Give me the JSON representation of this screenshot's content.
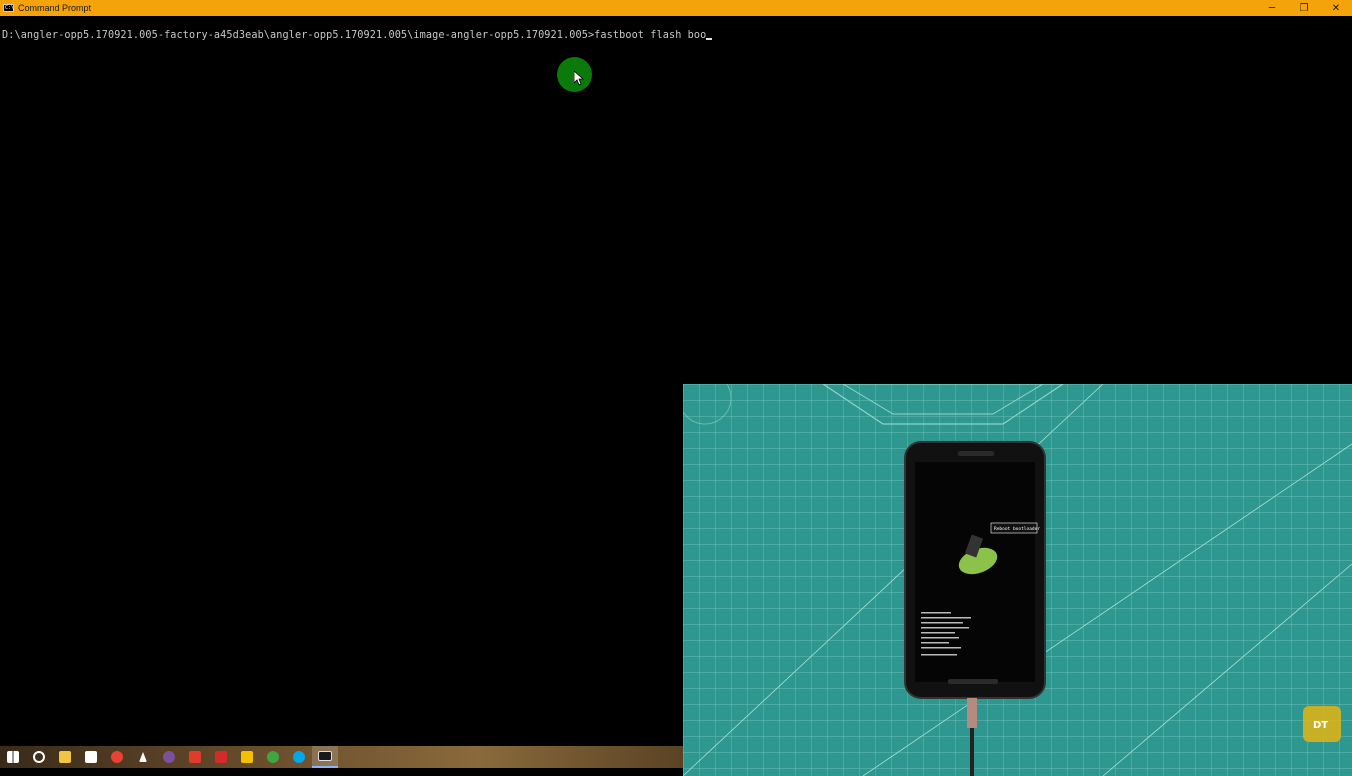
{
  "window": {
    "title": "Command Prompt",
    "icon_label": "C:\\",
    "controls": {
      "minimize": "─",
      "restore": "❐",
      "close": "✕"
    }
  },
  "console": {
    "prompt": "D:\\angler-opp5.170921.005-factory-a45d3eab\\angler-opp5.170921.005\\image-angler-opp5.170921.005>",
    "typed_command": "fastboot flash boo"
  },
  "video_overlay": {
    "phone_menu_label": "Reboot bootloader",
    "watermark": "DT"
  },
  "taskbar": {
    "items": [
      {
        "name": "start-button",
        "icon": "windows-icon",
        "color": "#ffffff"
      },
      {
        "name": "cortana-button",
        "icon": "circle-icon",
        "color": "#ffffff"
      },
      {
        "name": "file-explorer",
        "icon": "folder-icon",
        "color": "#f4c542"
      },
      {
        "name": "store",
        "icon": "bag-icon",
        "color": "#ffffff"
      },
      {
        "name": "chrome",
        "icon": "chrome-icon",
        "color": "#e94235"
      },
      {
        "name": "app-lightning",
        "icon": "lightning-icon",
        "color": "#ffffff"
      },
      {
        "name": "viber",
        "icon": "viber-icon",
        "color": "#7b519d"
      },
      {
        "name": "app-red",
        "icon": "red-app-icon",
        "color": "#e03b2c"
      },
      {
        "name": "app-shield",
        "icon": "shield-icon",
        "color": "#d42a2a"
      },
      {
        "name": "app-yellow",
        "icon": "yellow-app-icon",
        "color": "#f2c200"
      },
      {
        "name": "app-green",
        "icon": "green-app-icon",
        "color": "#3fa63f"
      },
      {
        "name": "skype",
        "icon": "skype-icon",
        "color": "#00a8e8"
      },
      {
        "name": "command-prompt",
        "icon": "cmd-icon",
        "color": "#1a1a1a",
        "active": true
      }
    ]
  }
}
